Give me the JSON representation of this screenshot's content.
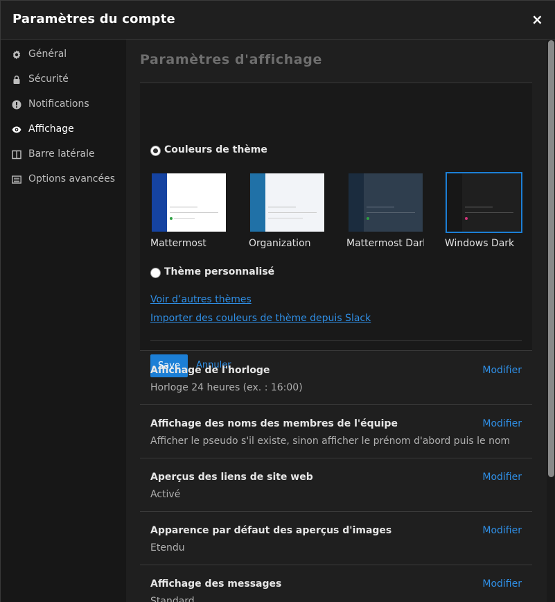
{
  "modal": {
    "title": "Paramètres du compte",
    "close_label": "×"
  },
  "sidebar": {
    "items": [
      {
        "label": "Général",
        "icon": "gear-icon"
      },
      {
        "label": "Sécurité",
        "icon": "lock-icon"
      },
      {
        "label": "Notifications",
        "icon": "alert-circle-icon"
      },
      {
        "label": "Affichage",
        "icon": "eye-icon",
        "active": true
      },
      {
        "label": "Barre latérale",
        "icon": "columns-icon"
      },
      {
        "label": "Options avancées",
        "icon": "list-icon"
      }
    ]
  },
  "display": {
    "title": "Paramètres d'affichage",
    "theme": {
      "preset_label": "Couleurs de thème",
      "custom_label": "Thème personnalisé",
      "options": [
        {
          "name": "Mattermost",
          "sidebar_color": "#1543a1",
          "main_color": "#ffffff"
        },
        {
          "name": "Organization",
          "sidebar_color": "#2071a7",
          "main_color": "#f2f4f8"
        },
        {
          "name": "Mattermost Dark",
          "sidebar_color": "#1b2c3e",
          "main_color": "#2f3e4e"
        },
        {
          "name": "Windows Dark",
          "sidebar_color": "#171717",
          "main_color": "#1f1f1f",
          "selected": true
        }
      ],
      "more_themes_link": "Voir d’autres thèmes",
      "import_slack_link": "Importer des couleurs de thème depuis Slack",
      "save_label": "Save",
      "cancel_label": "Annuler"
    },
    "settings": [
      {
        "title": "Affichage de l'horloge",
        "value": "Horloge 24 heures (ex. : 16:00)",
        "edit": "Modifier"
      },
      {
        "title": "Affichage des noms des membres de l'équipe",
        "value": "Afficher le pseudo s'il existe, sinon afficher le prénom d'abord puis le nom",
        "edit": "Modifier"
      },
      {
        "title": "Aperçus des liens de site web",
        "value": "Activé",
        "edit": "Modifier"
      },
      {
        "title": "Apparence par défaut des aperçus d'images",
        "value": "Etendu",
        "edit": "Modifier"
      },
      {
        "title": "Affichage des messages",
        "value": "Standard",
        "edit": "Modifier"
      }
    ]
  },
  "colors": {
    "accent": "#1c7fd6",
    "link": "#2f8fe6",
    "background": "#1f1f1f",
    "sidebar": "#171717"
  }
}
